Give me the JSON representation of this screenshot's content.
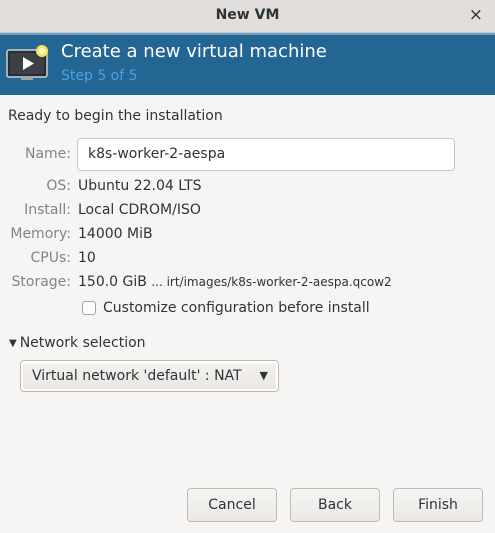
{
  "window": {
    "title": "New VM",
    "close_label": "×"
  },
  "header": {
    "title": "Create a new virtual machine",
    "step": "Step 5 of 5"
  },
  "ready_text": "Ready to begin the installation",
  "fields": {
    "name": {
      "label": "Name:",
      "value": "k8s-worker-2-aespa"
    },
    "os": {
      "label": "OS:",
      "value": "Ubuntu 22.04 LTS"
    },
    "install": {
      "label": "Install:",
      "value": "Local CDROM/ISO"
    },
    "memory": {
      "label": "Memory:",
      "value": "14000 MiB"
    },
    "cpus": {
      "label": "CPUs:",
      "value": "10"
    },
    "storage": {
      "label": "Storage:",
      "value": "150.0 GiB",
      "path": "... irt/images/k8s-worker-2-aespa.qcow2"
    }
  },
  "customize": {
    "label": "Customize configuration before install",
    "checked": false
  },
  "network": {
    "expander_label": "Network selection",
    "expanded": true,
    "selected": "Virtual network 'default' : NAT"
  },
  "buttons": {
    "cancel": "Cancel",
    "back": "Back",
    "finish": "Finish"
  },
  "colors": {
    "header_bg": "#236593",
    "step_text": "#4aa3e0",
    "label_text": "#7f8586"
  },
  "icons": {
    "header": "vm-monitor-icon",
    "expander": "triangle-down-icon",
    "combo": "chevron-down-icon"
  }
}
